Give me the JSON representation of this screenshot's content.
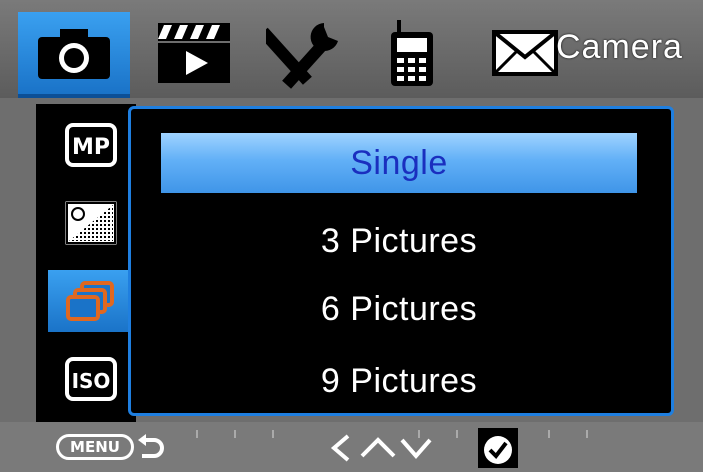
{
  "header": {
    "title": "Camera",
    "tabs": [
      {
        "name": "camera-tab",
        "icon": "camera-icon",
        "active": true
      },
      {
        "name": "video-tab",
        "icon": "clapperboard-icon",
        "active": false
      },
      {
        "name": "settings-tab",
        "icon": "tools-icon",
        "active": false
      },
      {
        "name": "cellular-tab",
        "icon": "phone-icon",
        "active": false
      },
      {
        "name": "message-tab",
        "icon": "envelope-icon",
        "active": false
      }
    ]
  },
  "sidebar": {
    "items": [
      {
        "label": "MP",
        "icon": "megapixel-icon",
        "active": false
      },
      {
        "label": "",
        "icon": "exposure-icon",
        "active": false
      },
      {
        "label": "",
        "icon": "burst-icon",
        "active": true
      },
      {
        "label": "ISO",
        "icon": "iso-icon",
        "active": false
      }
    ]
  },
  "menu": {
    "options": [
      "Single",
      "3 Pictures",
      "6 Pictures",
      "9 Pictures"
    ],
    "selected_index": 0
  },
  "footer": {
    "menu_label": "MENU",
    "hints": [
      "back-arrow-icon",
      "navigate-arrows-icon",
      "confirm-check-icon"
    ]
  },
  "colors": {
    "accent": "#1a73c8",
    "selected_text": "#1a2fbf",
    "panel_border": "#1f7fe0"
  }
}
